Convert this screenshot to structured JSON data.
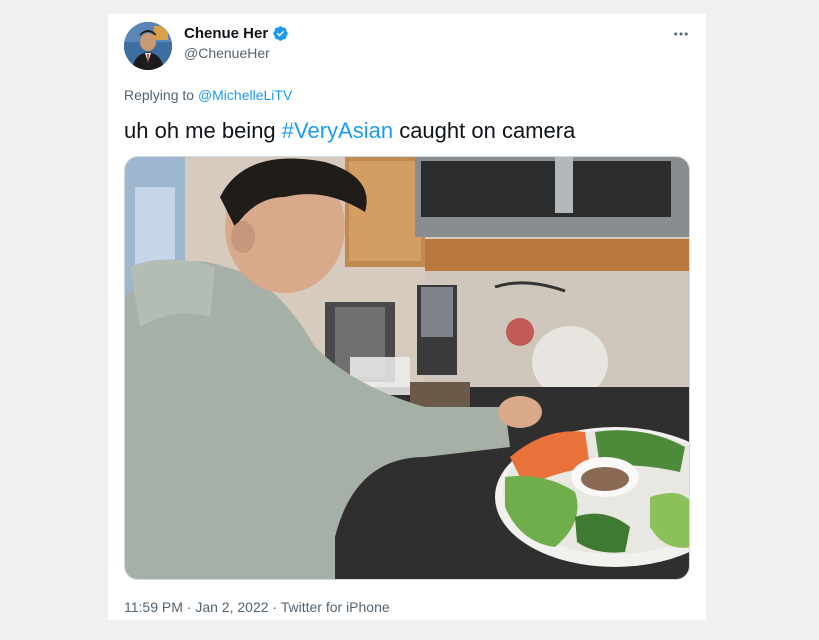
{
  "author": {
    "display_name": "Chenue Her",
    "handle": "@ChenueHer",
    "verified_icon": "verified-badge-icon",
    "verified_color": "#1d9bf0"
  },
  "more_icon": "more-horizontal-icon",
  "reply": {
    "prefix": "Replying to ",
    "mention": "@MichelleLiTV"
  },
  "tweet": {
    "text_before": "uh oh me being ",
    "hashtag": "#VeryAsian",
    "text_after": " caught on camera"
  },
  "media": {
    "description_icon": "photo-kitchen-icon"
  },
  "meta": {
    "time": "11:59 PM",
    "date": "Jan 2, 2022",
    "source": "Twitter for iPhone"
  },
  "colors": {
    "link": "#1d9bf0",
    "text": "#0f1419",
    "secondary": "#536471"
  }
}
